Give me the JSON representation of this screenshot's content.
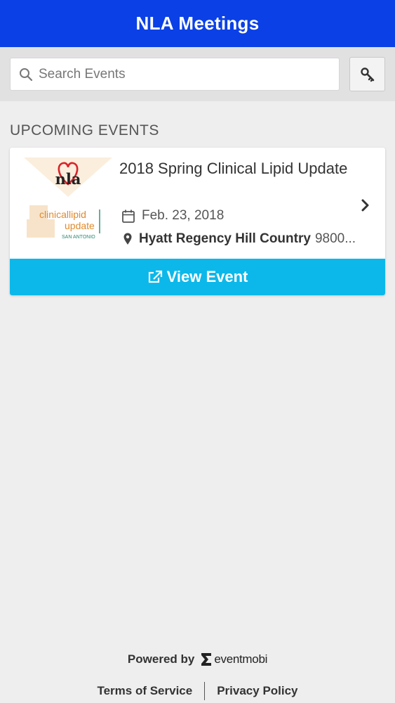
{
  "header": {
    "title": "NLA Meetings"
  },
  "search": {
    "placeholder": "Search Events",
    "value": ""
  },
  "toolbar": {
    "key_icon": "key-icon"
  },
  "section": {
    "title": "UPCOMING EVENTS"
  },
  "event": {
    "title": "2018 Spring Clinical Lipid Update",
    "date": "Feb. 23, 2018",
    "venue_name": "Hyatt Regency Hill Country",
    "venue_address": "9800...",
    "logo": {
      "mark_text": "nla",
      "line1": "clinicallipid",
      "line2": "update",
      "line3": "SAN ANTONIO"
    },
    "button_label": "View Event",
    "icons": {
      "date": "calendar-icon",
      "venue": "map-pin-icon",
      "button": "external-link-icon",
      "chevron": "chevron-right-icon"
    }
  },
  "footer": {
    "powered_label": "Powered by",
    "brand_name": "eventmobi",
    "links": [
      "Terms of Service",
      "Privacy Policy"
    ]
  },
  "colors": {
    "header_bg": "#0a40e6",
    "button_bg": "#0cb8ea",
    "page_bg": "#efeeef"
  }
}
